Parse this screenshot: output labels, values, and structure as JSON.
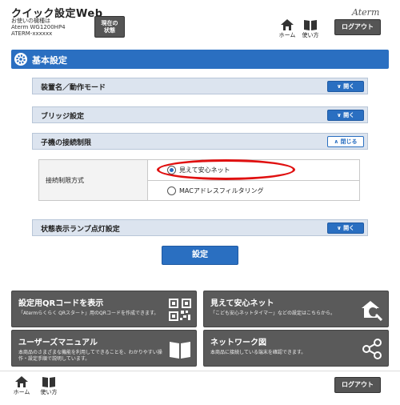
{
  "header": {
    "app_title": "クイック設定Web",
    "device_label": "お使いの機種は",
    "device_model": "Aterm WG1200HP4",
    "device_ssid": "ATERM-xxxxxx",
    "status_button_line1": "現在の",
    "status_button_line2": "状態",
    "brand": "Aterm",
    "home_label": "ホーム",
    "help_label": "使い方",
    "logout_label": "ログアウト"
  },
  "section": {
    "title": "基本設定"
  },
  "settings": [
    {
      "label": "装置名／動作モード",
      "toggle": "開く"
    },
    {
      "label": "ブリッジ設定",
      "toggle": "開く"
    },
    {
      "label": "子機の接続制限",
      "toggle": "閉じる"
    },
    {
      "label": "状態表示ランプ点灯設定",
      "toggle": "開く"
    }
  ],
  "connection_limit": {
    "method_label": "接続制限方式",
    "options": [
      {
        "label": "見えて安心ネット",
        "checked": true
      },
      {
        "label": "MACアドレスフィルタリング",
        "checked": false
      }
    ]
  },
  "save_label": "設定",
  "tiles": [
    {
      "title": "設定用QRコードを表示",
      "desc": "「Atermらくらく QRスタート」用のQRコードを作成できます。",
      "icon": "qr-code-icon"
    },
    {
      "title": "見えて安心ネット",
      "desc": "「こども安心ネットタイマー」などの設定はこちらから。",
      "icon": "home-search-icon"
    },
    {
      "title": "ユーザーズマニュアル",
      "desc": "本商品のさまざまな機能を利用してできることを、わかりやすい操作・設定手順で説明しています。",
      "icon": "book-icon"
    },
    {
      "title": "ネットワーク図",
      "desc": "本商品に接続している端末を確認できます。",
      "icon": "network-share-icon"
    }
  ],
  "footer": {
    "home_label": "ホーム",
    "help_label": "使い方",
    "logout_label": "ログアウト"
  },
  "colors": {
    "accent": "#2a6fc1",
    "tile_bg": "#5a5a5a",
    "highlight": "#e01010"
  }
}
